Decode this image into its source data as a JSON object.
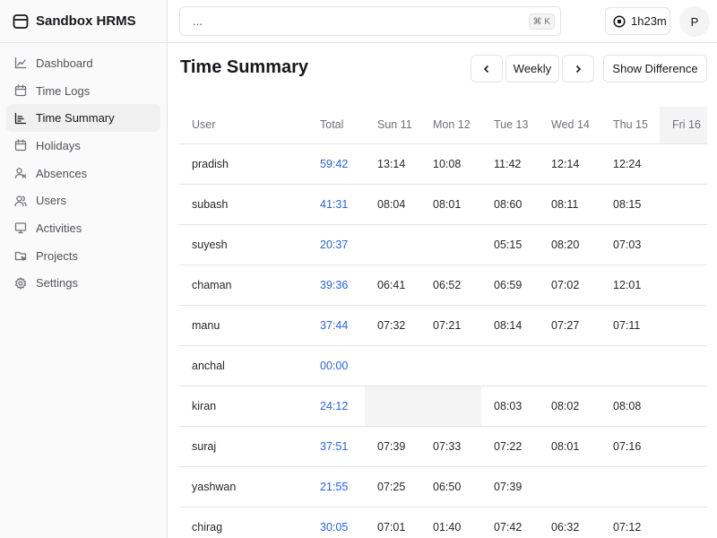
{
  "app": {
    "name": "Sandbox HRMS"
  },
  "sidebar": {
    "items": [
      {
        "label": "Dashboard",
        "icon": "chart-line-icon",
        "active": false
      },
      {
        "label": "Time Logs",
        "icon": "calendar-icon",
        "active": false
      },
      {
        "label": "Time Summary",
        "icon": "bar-chart-icon",
        "active": true
      },
      {
        "label": "Holidays",
        "icon": "calendar-icon",
        "active": false
      },
      {
        "label": "Absences",
        "icon": "user-x-icon",
        "active": false
      },
      {
        "label": "Users",
        "icon": "users-icon",
        "active": false
      },
      {
        "label": "Activities",
        "icon": "monitor-icon",
        "active": false
      },
      {
        "label": "Projects",
        "icon": "folder-icon",
        "active": false
      },
      {
        "label": "Settings",
        "icon": "gear-icon",
        "active": false
      }
    ]
  },
  "topbar": {
    "search_value": "...",
    "shortcut": "⌘ K",
    "timer": "1h23m",
    "avatar_initial": "P"
  },
  "main": {
    "title": "Time Summary",
    "prev_label": "‹",
    "period_label": "Weekly",
    "next_label": "›",
    "diff_label": "Show Difference"
  },
  "table": {
    "columns": [
      "User",
      "Total",
      "Sun 11",
      "Mon 12",
      "Tue 13",
      "Wed 14",
      "Thu 15",
      "Fri 16"
    ],
    "rows": [
      [
        "pradish",
        "59:42",
        "13:14",
        "10:08",
        "11:42",
        "12:14",
        "12:24",
        ""
      ],
      [
        "subash",
        "41:31",
        "08:04",
        "08:01",
        "08:60",
        "08:11",
        "08:15",
        ""
      ],
      [
        "suyesh",
        "20:37",
        "",
        "",
        "05:15",
        "08:20",
        "07:03",
        ""
      ],
      [
        "chaman",
        "39:36",
        "06:41",
        "06:52",
        "06:59",
        "07:02",
        "12:01",
        ""
      ],
      [
        "manu",
        "37:44",
        "07:32",
        "07:21",
        "08:14",
        "07:27",
        "07:11",
        ""
      ],
      [
        "anchal",
        "00:00",
        "",
        "",
        "",
        "",
        "",
        ""
      ],
      [
        "kiran",
        "24:12",
        "",
        "",
        "08:03",
        "08:02",
        "08:08",
        ""
      ],
      [
        "suraj",
        "37:51",
        "07:39",
        "07:33",
        "07:22",
        "08:01",
        "07:16",
        ""
      ],
      [
        "yashwan",
        "21:55",
        "07:25",
        "06:50",
        "07:39",
        "",
        "",
        ""
      ],
      [
        "chirag",
        "30:05",
        "07:01",
        "01:40",
        "07:42",
        "06:32",
        "07:12",
        ""
      ]
    ]
  },
  "colors": {
    "accent": "#2563eb",
    "border": "#e4e4e7",
    "muted": "#71717a"
  }
}
